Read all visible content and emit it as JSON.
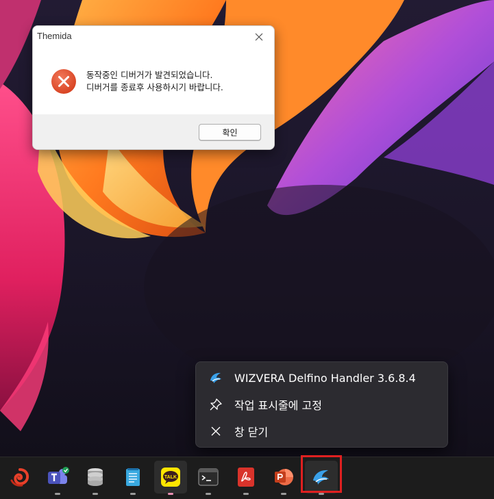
{
  "dialog": {
    "title": "Themida",
    "message_line1": "동작중인 디버거가 발견되었습니다.",
    "message_line2": "디버거를 종료후 사용하시기 바랍니다.",
    "ok_label": "확인",
    "icon": "error-icon"
  },
  "jumplist": {
    "items": [
      {
        "label": "WIZVERA Delfino Handler 3.6.8.4",
        "icon": "delfino-icon"
      },
      {
        "label": "작업 표시줄에 고정",
        "icon": "pin-icon"
      },
      {
        "label": "창 닫기",
        "icon": "close-icon"
      }
    ]
  },
  "taskbar": {
    "apps": [
      {
        "name": "swirl-app",
        "icon": "swirl-icon"
      },
      {
        "name": "teams",
        "icon": "teams-icon"
      },
      {
        "name": "database",
        "icon": "database-icon"
      },
      {
        "name": "notepad",
        "icon": "notepad-icon"
      },
      {
        "name": "kakaotalk",
        "icon": "kakaotalk-icon",
        "badge_text": "TALK"
      },
      {
        "name": "terminal",
        "icon": "terminal-icon"
      },
      {
        "name": "pdf-reader",
        "icon": "pdf-icon"
      },
      {
        "name": "powerpoint",
        "icon": "powerpoint-icon"
      },
      {
        "name": "delfino",
        "icon": "delfino-icon"
      }
    ]
  },
  "colors": {
    "error_red": "#e2543a",
    "highlight": "#e02020",
    "taskbar_bg": "#1c1c1c",
    "jumplist_bg": "#2c2b30"
  }
}
